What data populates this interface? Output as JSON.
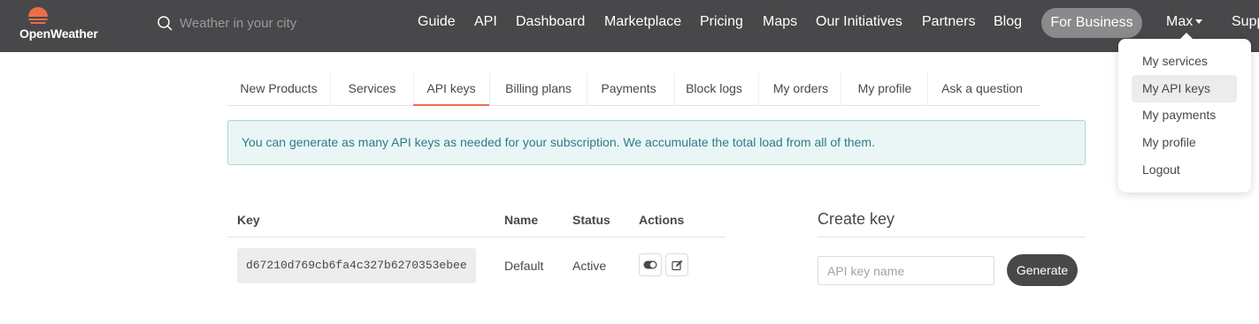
{
  "header": {
    "logo_text": "OpenWeather",
    "search_placeholder": "Weather in your city",
    "nav": [
      "Guide",
      "API",
      "Dashboard",
      "Marketplace",
      "Pricing",
      "Maps",
      "Our Initiatives",
      "Partners",
      "Blog"
    ],
    "for_business": "For Business",
    "user": "Max",
    "support_partial": "Supp"
  },
  "user_dropdown": {
    "items": [
      "My services",
      "My API keys",
      "My payments",
      "My profile",
      "Logout"
    ],
    "active": "My API keys"
  },
  "tabs": {
    "items": [
      "New Products",
      "Services",
      "API keys",
      "Billing plans",
      "Payments",
      "Block logs",
      "My orders",
      "My profile",
      "Ask a question"
    ],
    "active": "API keys"
  },
  "alert": {
    "text": "You can generate as many API keys as needed for your subscription. We accumulate the total load from all of them."
  },
  "keys_table": {
    "headers": [
      "Key",
      "Name",
      "Status",
      "Actions"
    ],
    "rows": [
      {
        "key": "d67210d769cb6fa4c327b6270353ebee",
        "name": "Default",
        "status": "Active"
      }
    ],
    "action_icons": [
      "toggle-icon",
      "edit-icon"
    ]
  },
  "create_key": {
    "title": "Create key",
    "input_placeholder": "API key name",
    "button": "Generate"
  },
  "colors": {
    "topbar": "#48484a",
    "accent": "#eb6e4b",
    "alert_bg": "#eaf6f6",
    "alert_text": "#2d7b8a"
  }
}
